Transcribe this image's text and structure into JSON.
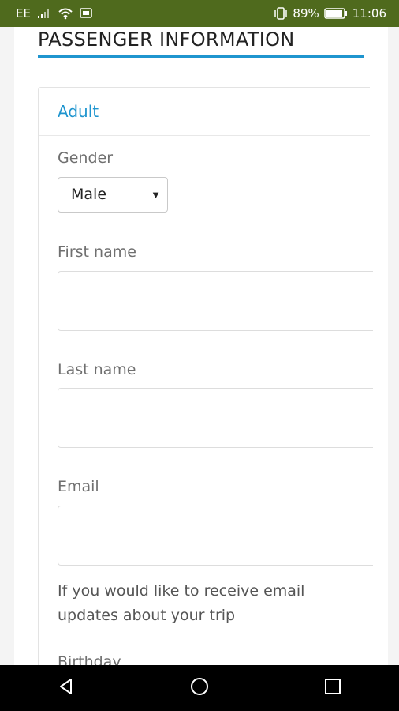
{
  "status_bar": {
    "carrier": "EE",
    "battery_percent": "89%",
    "time": "11:06",
    "icons": [
      "signal-icon",
      "wifi-icon",
      "message-icon",
      "vibrate-icon",
      "battery-icon"
    ]
  },
  "page": {
    "section_title": "PASSENGER INFORMATION",
    "accent_color": "#1f95cf",
    "card": {
      "title": "Adult",
      "gender_label": "Gender",
      "gender_value": "Male",
      "first_name_label": "First name",
      "first_name_value": "",
      "last_name_label": "Last name",
      "last_name_value": "",
      "email_label": "Email",
      "email_value": "",
      "email_help": "If you would like to receive email updates about your trip",
      "birthday_label": "Birthday"
    }
  },
  "nav_bar": {
    "icons": [
      "back-icon",
      "home-icon",
      "recents-icon"
    ]
  }
}
